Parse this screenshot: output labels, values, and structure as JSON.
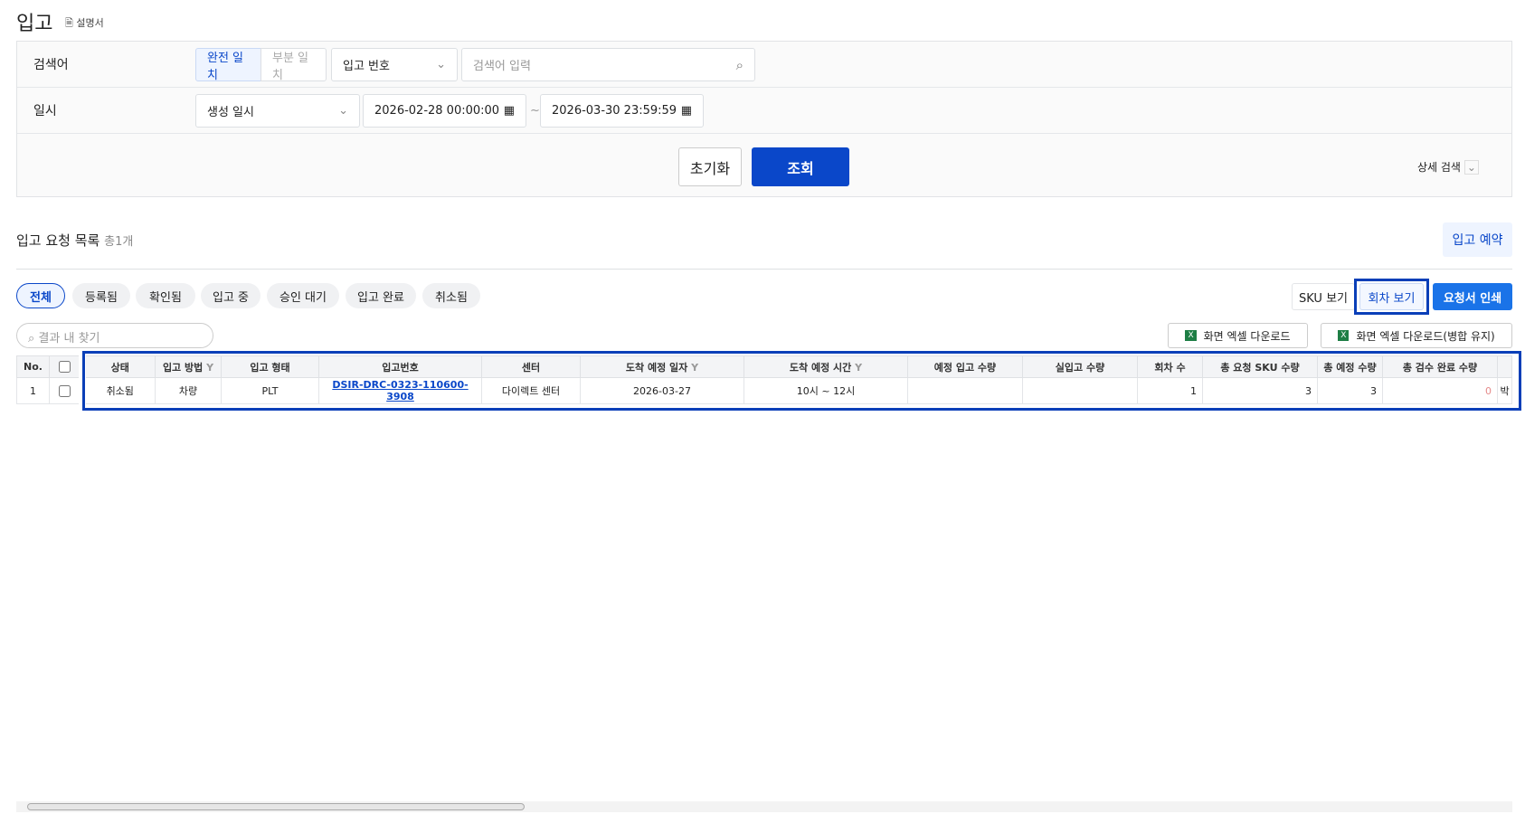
{
  "header": {
    "title": "입고",
    "manual": "설명서"
  },
  "search": {
    "keyword_label": "검색어",
    "exact": "완전 일치",
    "partial": "부분 일치",
    "field": "입고 번호",
    "placeholder": "검색어 입력",
    "date_label": "일시",
    "date_type": "생성 일시",
    "date_from": "2026-02-28 00:00:00",
    "sep": "~",
    "date_to": "2026-03-30 23:59:59",
    "reset": "초기화",
    "submit": "조회",
    "advanced": "상세 검색"
  },
  "list": {
    "title": "입고 요청 목록",
    "count": "총1개",
    "reserve": "입고 예약",
    "tabs": [
      "전체",
      "등록됨",
      "확인됨",
      "입고 중",
      "승인 대기",
      "입고 완료",
      "취소됨"
    ],
    "sku_view": "SKU 보기",
    "round_view": "회차 보기",
    "print": "요청서 인쇄",
    "find_placeholder": "결과 내 찾기",
    "excel": "화면 엑셀 다운로드",
    "excel_merge": "화면 엑셀 다운로드(병합 유지)"
  },
  "table": {
    "headers": [
      "No.",
      "",
      "상태",
      "입고 방법",
      "입고 형태",
      "입고번호",
      "센터",
      "도착 예정 일자",
      "도착 예정 시간",
      "예정 입고 수량",
      "실입고 수량",
      "회차 수",
      "총 요청 SKU 수량",
      "총 예정 수량",
      "총 검수 완료 수량",
      ""
    ],
    "rows": [
      [
        "1",
        "",
        "취소됨",
        "차량",
        "PLT",
        "DSIR-DRC-0323-110600-3908",
        "다이렉트 센터",
        "2026-03-27",
        "10시 ~ 12시",
        "",
        "",
        "1",
        "3",
        "3",
        "0",
        "박"
      ]
    ]
  },
  "colors": {
    "primary": "#0a47c9",
    "accent": "#1a73e8",
    "highlight": "#0a3fb8"
  }
}
